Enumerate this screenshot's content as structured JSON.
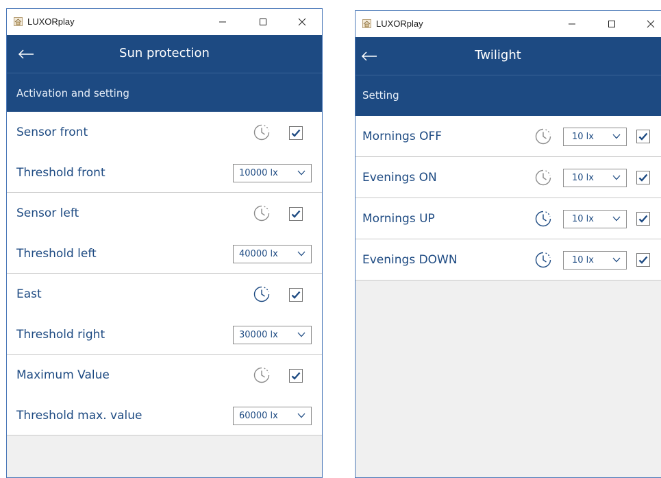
{
  "left_window": {
    "app_title": "LUXORplay",
    "title": "Sun protection",
    "section": "Activation and setting",
    "groups": [
      {
        "sensor_label": "Sensor front",
        "threshold_label": "Threshold front",
        "threshold_value": "10000 lx",
        "checked": true
      },
      {
        "sensor_label": "Sensor left",
        "threshold_label": "Threshold left",
        "threshold_value": "40000 lx",
        "checked": true
      },
      {
        "sensor_label": "East",
        "threshold_label": "Threshold right",
        "threshold_value": "30000 lx",
        "checked": true
      },
      {
        "sensor_label": "Maximum Value",
        "threshold_label": "Threshold max. value",
        "threshold_value": "60000 lx",
        "checked": true
      }
    ]
  },
  "right_window": {
    "app_title": "LUXORplay",
    "title": "Twilight",
    "section": "Setting",
    "rows": [
      {
        "label": "Mornings OFF",
        "value": "10 lx",
        "checked": true
      },
      {
        "label": "Evenings ON",
        "value": "10 lx",
        "checked": true
      },
      {
        "label": "Mornings UP",
        "value": "10 lx",
        "checked": true
      },
      {
        "label": "Evenings DOWN",
        "value": "10 lx",
        "checked": true
      }
    ]
  },
  "icons": {
    "app": "house-icon",
    "back": "arrow-left-icon",
    "time": "clock-icon",
    "check": "checkmark-icon",
    "dropdown": "chevron-down-icon",
    "minimize": "minimize-icon",
    "maximize": "maximize-icon",
    "close": "close-icon"
  },
  "colors": {
    "header": "#1d4a82",
    "label_text": "#1d4a82",
    "background": "#f0f0f0"
  }
}
